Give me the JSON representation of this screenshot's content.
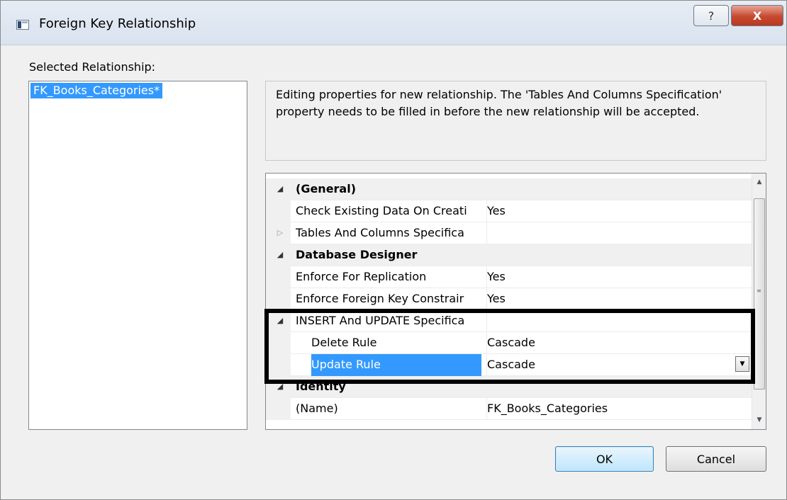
{
  "window": {
    "title": "Foreign Key Relationship",
    "help_glyph": "?",
    "close_glyph": "X"
  },
  "selected_label": "Selected Relationship:",
  "relationships": [
    {
      "label": "FK_Books_Categories*"
    }
  ],
  "description": "Editing properties for new relationship.  The 'Tables And Columns Specification' property needs to be filled in before the new relationship will be accepted.",
  "properties": {
    "general": {
      "label": "(General)"
    },
    "check_existing": {
      "name": "Check Existing Data On Creati",
      "value": "Yes"
    },
    "tables_columns": {
      "name": "Tables And Columns Specifica",
      "value": ""
    },
    "database_designer": {
      "label": "Database Designer"
    },
    "enforce_replication": {
      "name": "Enforce For Replication",
      "value": "Yes"
    },
    "enforce_fk": {
      "name": "Enforce Foreign Key Constrair",
      "value": "Yes"
    },
    "insert_update": {
      "name": "INSERT And UPDATE Specifica",
      "value": ""
    },
    "delete_rule": {
      "name": "Delete Rule",
      "value": "Cascade"
    },
    "update_rule": {
      "name": "Update Rule",
      "value": "Cascade"
    },
    "identity": {
      "label": "Identity"
    },
    "name_prop": {
      "name": "(Name)",
      "value": "FK_Books_Categories"
    }
  },
  "buttons": {
    "ok": "OK",
    "cancel": "Cancel"
  },
  "colors": {
    "selection": "#3399ff",
    "highlight_border": "#000000",
    "close_button": "#c6492f"
  }
}
